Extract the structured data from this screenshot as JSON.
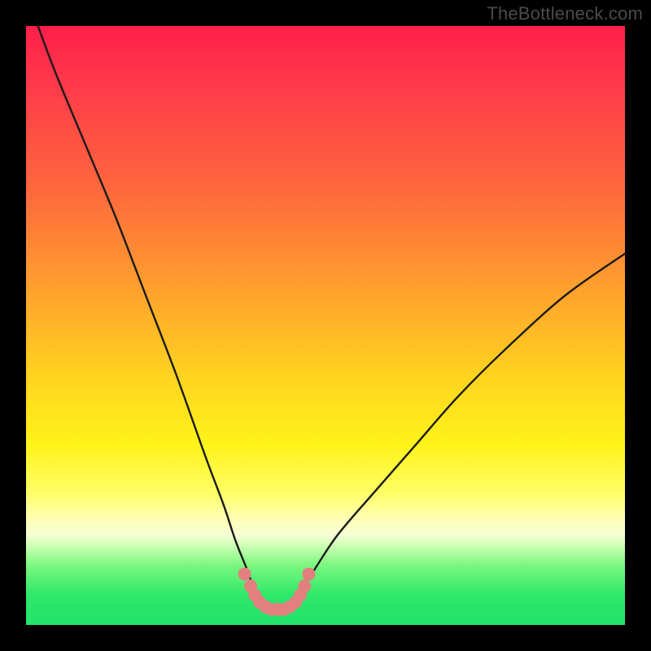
{
  "watermark": "TheBottleneck.com",
  "chart_data": {
    "type": "line",
    "title": "",
    "xlabel": "",
    "ylabel": "",
    "xlim": [
      0,
      100
    ],
    "ylim": [
      0,
      100
    ],
    "grid": false,
    "legend": false,
    "series": [
      {
        "name": "bottleneck-curve",
        "x": [
          2,
          5,
          10,
          15,
          20,
          25,
          30,
          33,
          35,
          37,
          38,
          39,
          40,
          41,
          42,
          43,
          44,
          45,
          46,
          48,
          52,
          58,
          65,
          72,
          80,
          90,
          100
        ],
        "y": [
          100,
          92,
          80,
          68,
          55,
          42,
          28,
          20,
          14,
          9,
          6,
          4,
          3,
          2.5,
          2.5,
          2.5,
          3,
          4,
          6,
          9,
          15,
          22,
          30,
          38,
          46,
          55,
          62
        ]
      },
      {
        "name": "bottleneck-markers",
        "x": [
          36.5,
          37.5,
          38.2,
          39,
          40,
          41,
          42,
          43,
          44,
          45,
          45.8,
          46.5,
          47.2
        ],
        "y": [
          8.5,
          6.5,
          5,
          3.8,
          3,
          2.6,
          2.6,
          2.6,
          3,
          3.8,
          5,
          6.5,
          8.5
        ]
      }
    ],
    "colors": {
      "curve": "#1a1a1a",
      "markers": "#e37f7f",
      "gradient_stops": [
        "#ff1f4a",
        "#ff6a3c",
        "#ffd21f",
        "#ffff66",
        "#22e36a"
      ]
    }
  }
}
